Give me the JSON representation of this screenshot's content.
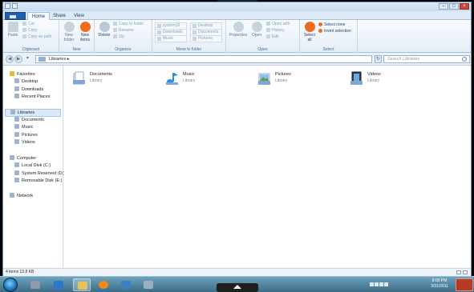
{
  "tabs": [
    "Home",
    "Share",
    "View"
  ],
  "ribbon": {
    "clipboard": {
      "label": "Clipboard",
      "paste": "Paste",
      "cut": "Cut",
      "copy": "Copy",
      "copy_as_path": "Copy as path"
    },
    "new": {
      "label": "New",
      "new_folder": "New folder",
      "new_items": "New items"
    },
    "organize": {
      "label": "Organize",
      "delete": "Delete",
      "copy_to_folder": "Copy to folder",
      "rename": "Rename",
      "zip": "Zip"
    },
    "move": {
      "label": "Move to folder",
      "folders": [
        "system32",
        "Desktop",
        "Downloads",
        "Documents",
        "Music",
        "Pictures"
      ]
    },
    "open": {
      "label": "Open",
      "properties": "Properties",
      "open": "Open",
      "open_with": "Open with",
      "history": "History",
      "edit": "Edit"
    },
    "select": {
      "label": "Select",
      "select_all": "Select all",
      "select_none": "Select none",
      "invert": "Invert selection"
    }
  },
  "address": {
    "path": "Libraries",
    "search_placeholder": "Search Libraries"
  },
  "nav": {
    "favorites": "Favorites",
    "fav_items": [
      "Desktop",
      "Downloads",
      "Recent Places"
    ],
    "libraries": "Libraries",
    "lib_items": [
      "Documents",
      "Music",
      "Pictures",
      "Videos"
    ],
    "computer": "Computer",
    "drives": [
      "Local Disk (C:)",
      "System Reserved (D:)",
      "Removable Disk (E:)"
    ],
    "network": "Network"
  },
  "libraries": [
    {
      "name": "Documents",
      "type": "Library"
    },
    {
      "name": "Music",
      "type": "Library"
    },
    {
      "name": "Pictures",
      "type": "Library"
    },
    {
      "name": "Videos",
      "type": "Library"
    }
  ],
  "status": "4 items  13.8 KB",
  "clock": {
    "time": "8:00 PM",
    "date": "3/31/2011"
  },
  "colors": {
    "accent": "#f06a1e",
    "file_tab": "#1e5fae",
    "taskbar": "#3c6c86"
  }
}
